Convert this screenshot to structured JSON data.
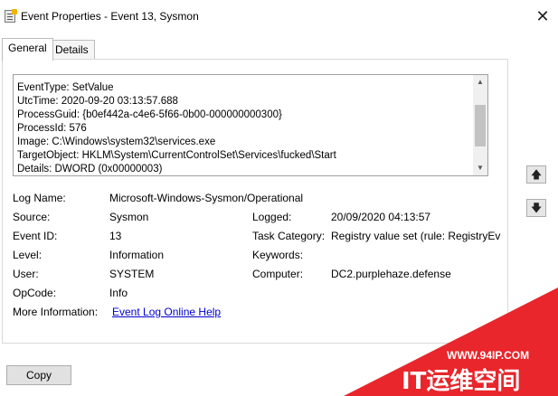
{
  "window": {
    "title": "Event Properties - Event 13, Sysmon"
  },
  "tabs": [
    {
      "label": "General"
    },
    {
      "label": "Details"
    }
  ],
  "event_text": {
    "lines": [
      "EventType: SetValue",
      "UtcTime: 2020-09-20 03:13:57.688",
      "ProcessGuid: {b0ef442a-c4e6-5f66-0b00-000000000300}",
      "ProcessId: 576",
      "Image: C:\\Windows\\system32\\services.exe",
      "TargetObject: HKLM\\System\\CurrentControlSet\\Services\\fucked\\Start",
      "Details: DWORD (0x00000003)"
    ]
  },
  "fields": {
    "log_name": {
      "label": "Log Name:",
      "value": "Microsoft-Windows-Sysmon/Operational"
    },
    "source": {
      "label": "Source:",
      "value": "Sysmon"
    },
    "logged": {
      "label": "Logged:",
      "value": "20/09/2020 04:13:57"
    },
    "event_id": {
      "label": "Event ID:",
      "value": "13"
    },
    "task_category": {
      "label": "Task Category:",
      "value": "Registry value set (rule: RegistryEv"
    },
    "level": {
      "label": "Level:",
      "value": "Information"
    },
    "keywords": {
      "label": "Keywords:",
      "value": ""
    },
    "user": {
      "label": "User:",
      "value": "SYSTEM"
    },
    "computer": {
      "label": "Computer:",
      "value": "DC2.purplehaze.defense"
    },
    "opcode": {
      "label": "OpCode:",
      "value": "Info"
    },
    "more_info": {
      "label": "More Information:",
      "link": "Event Log Online Help"
    }
  },
  "buttons": {
    "copy": "Copy"
  },
  "watermark": {
    "url": "WWW.94IP.COM",
    "brand": "IT运维空间",
    "color": "#e8262b"
  }
}
